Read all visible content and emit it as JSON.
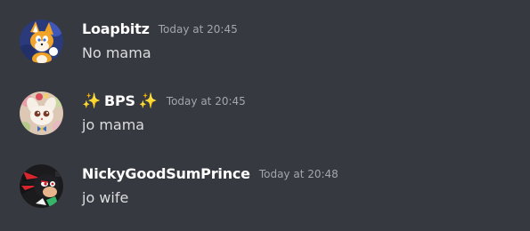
{
  "messages": [
    {
      "username": "Loapbitz",
      "timestamp": "Today at 20:45",
      "content": "No mama",
      "avatar": "tails-fox-avatar"
    },
    {
      "username": "BPS",
      "username_prefix": "✨",
      "username_suffix": "✨",
      "timestamp": "Today at 20:45",
      "content": "jo mama",
      "avatar": "cream-rabbit-avatar"
    },
    {
      "username": "NickyGoodSumPrince",
      "timestamp": "Today at 20:48",
      "content": "jo wife",
      "avatar": "shadow-hedgehog-avatar"
    }
  ],
  "colors": {
    "background": "#36393f",
    "username": "#ffffff",
    "timestamp": "#a3a6aa",
    "message_text": "#dcddde"
  }
}
